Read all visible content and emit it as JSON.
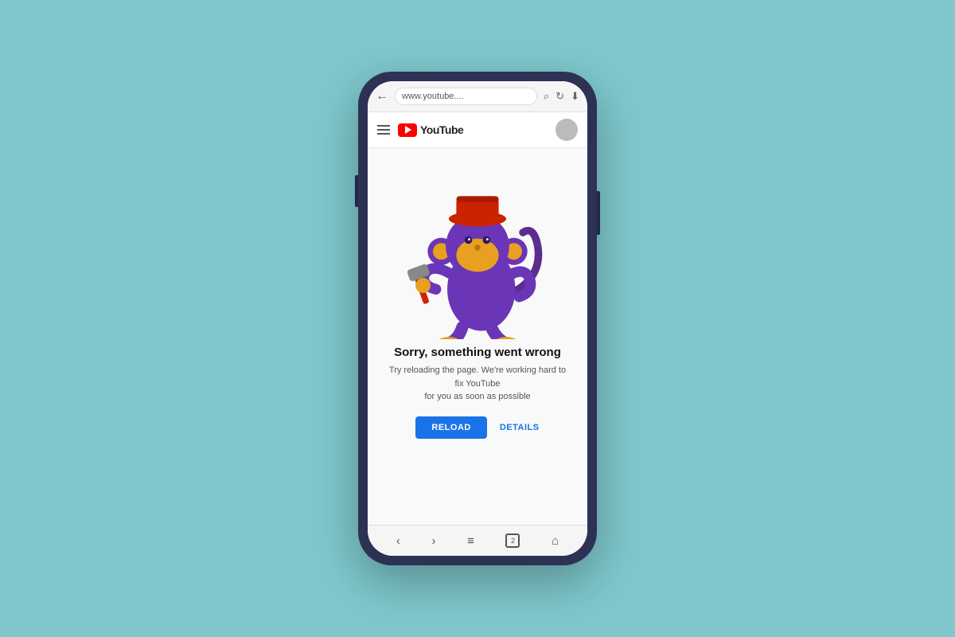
{
  "background": {
    "color": "#7ec8cc"
  },
  "phone": {
    "outer_color": "#2d3154"
  },
  "browser": {
    "address": "www.youtube....",
    "back_icon": "←",
    "search_icon": "🔍",
    "reload_icon": "↻",
    "download_icon": "⬇"
  },
  "youtube": {
    "logo_text": "YouTube",
    "logo_color": "#ff0000"
  },
  "error": {
    "title": "Sorry, something went wrong",
    "subtitle_line1": "Try reloading the page. We're working hard to fix YouTube",
    "subtitle_line2": "for you as soon as possible",
    "reload_button": "RELOAD",
    "details_button": "DETAILS"
  },
  "browser_nav": {
    "back": "‹",
    "forward": "›",
    "menu": "≡",
    "tabs": "2",
    "home": "⌂"
  }
}
